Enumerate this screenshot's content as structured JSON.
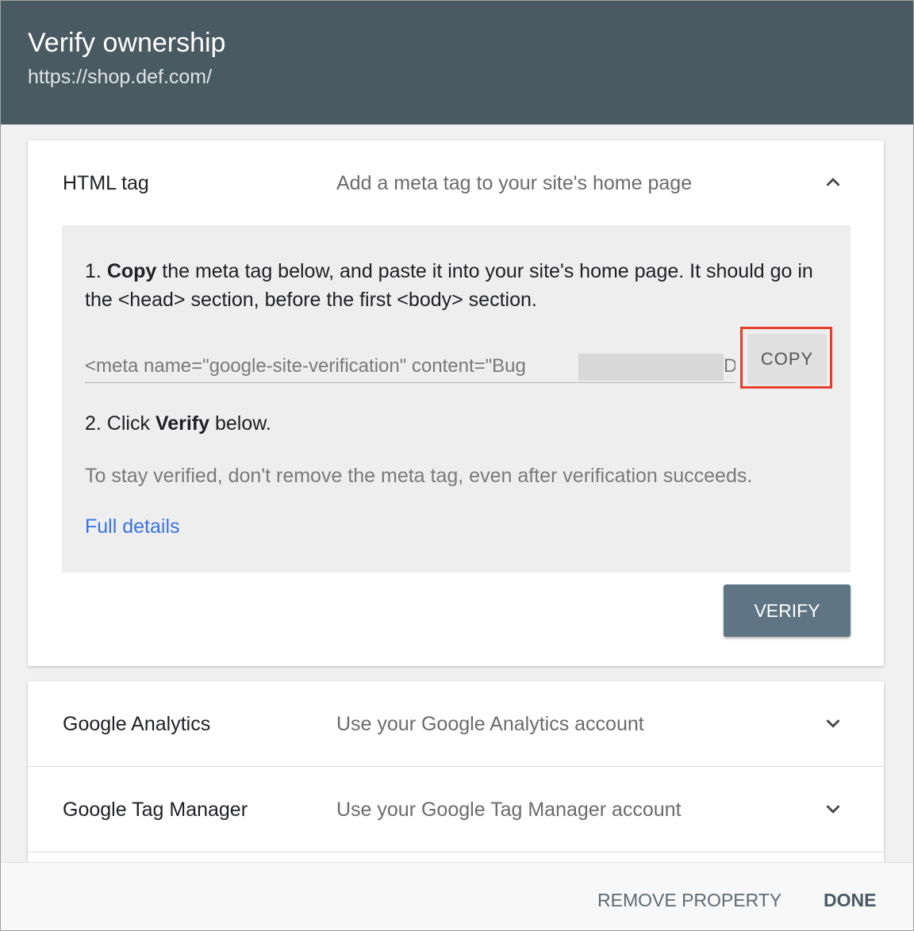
{
  "dialog": {
    "title": "Verify ownership",
    "url": "https://shop.def.com/"
  },
  "methods": {
    "html_tag": {
      "name": "HTML tag",
      "description": "Add a meta tag to your site's home page",
      "chevron": "chevron-up-icon",
      "step1_number": "1.",
      "step1_bold": "Copy",
      "step1_rest": " the meta tag below, and paste it into your site's home page. It should go in the <head> section, before the first <body> section.",
      "meta_tag_value": "<meta name=\"google-site-verification\" content=\"Bug",
      "meta_tag_tail": "D",
      "copy_label": "COPY",
      "step2_prefix": "2. Click ",
      "step2_bold": "Verify",
      "step2_suffix": " below.",
      "note": "To stay verified, don't remove the meta tag, even after verification succeeds.",
      "link": "Full details",
      "verify_label": "VERIFY"
    },
    "google_analytics": {
      "name": "Google Analytics",
      "description": "Use your Google Analytics account",
      "chevron": "chevron-down-icon"
    },
    "google_tag_manager": {
      "name": "Google Tag Manager",
      "description": "Use your Google Tag Manager account",
      "chevron": "chevron-down-icon"
    }
  },
  "footer": {
    "remove_label": "REMOVE PROPERTY",
    "done_label": "DONE"
  },
  "colors": {
    "header_bg": "#4a5a63",
    "verify_button": "#607583",
    "link": "#3c73e0",
    "highlight": "#e5402d"
  }
}
